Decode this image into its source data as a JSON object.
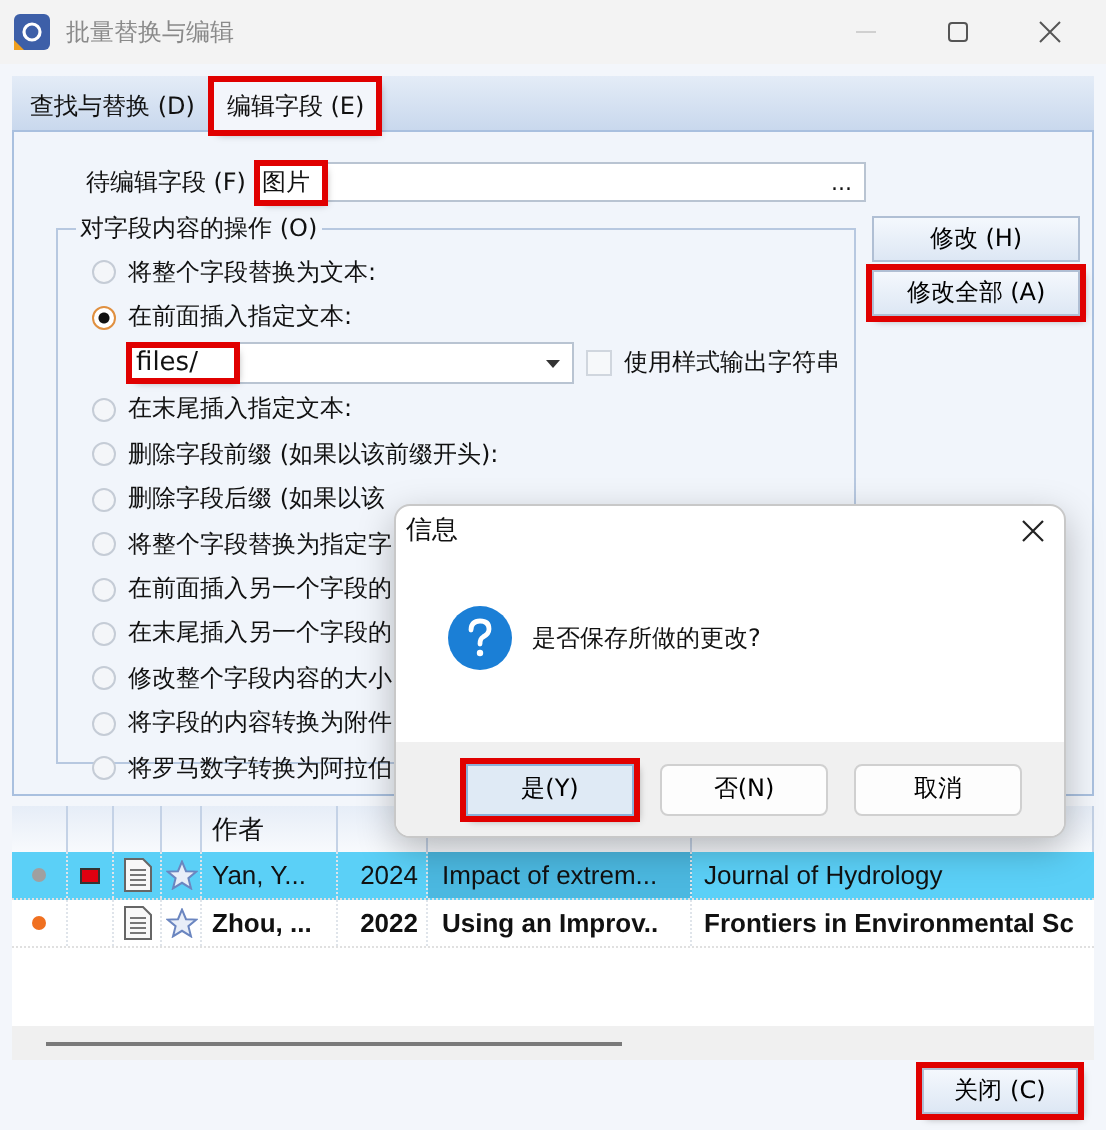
{
  "window": {
    "title": "批量替换与编辑"
  },
  "tabs": [
    {
      "label": "查找与替换 (D)",
      "selected": false,
      "highlighted": false
    },
    {
      "label": "编辑字段 (E)",
      "selected": true,
      "highlighted": true
    }
  ],
  "field": {
    "label": "待编辑字段 (F)",
    "value": "图片",
    "highlighted": true,
    "browse": "..."
  },
  "group": {
    "title": "对字段内容的操作 (O)",
    "options": [
      {
        "label": "将整个字段替换为文本:",
        "selected": false
      },
      {
        "label": "在前面插入指定文本:",
        "selected": true,
        "input": {
          "value": "files/",
          "highlighted": true
        },
        "checkbox": {
          "label": "使用样式输出字符串",
          "checked": false
        }
      },
      {
        "label": "在末尾插入指定文本:",
        "selected": false
      },
      {
        "label": "删除字段前缀 (如果以该前缀开头):",
        "selected": false
      },
      {
        "label": "删除字段后缀 (如果以该",
        "selected": false
      },
      {
        "label": "将整个字段替换为指定字",
        "selected": false
      },
      {
        "label": "在前面插入另一个字段的",
        "selected": false
      },
      {
        "label": "在末尾插入另一个字段的",
        "selected": false
      },
      {
        "label": "修改整个字段内容的大小",
        "selected": false
      },
      {
        "label": "将字段的内容转换为附件",
        "selected": false
      },
      {
        "label": "将罗马数字转换为阿拉伯",
        "selected": false
      }
    ]
  },
  "side_buttons": [
    {
      "label": "修改 (H)",
      "highlighted": false
    },
    {
      "label": "修改全部 (A)",
      "highlighted": true
    }
  ],
  "table": {
    "author_column": "作者",
    "rows": [
      {
        "selected": true,
        "color": "#a0a0a0",
        "flagged": true,
        "bold": false,
        "author": "Yan, Y...",
        "year": "2024",
        "title": "Impact of extrem...",
        "source": "Journal of Hydrology"
      },
      {
        "selected": false,
        "color": "#f07020",
        "flagged": false,
        "bold": true,
        "author": "Zhou, ...",
        "year": "2022",
        "title": "Using an Improv..",
        "source": "Frontiers in Environmental Sc"
      }
    ]
  },
  "close_button": {
    "label": "关闭 (C)",
    "highlighted": true
  },
  "dialog": {
    "title": "信息",
    "message": "是否保存所做的更改?",
    "buttons": [
      {
        "label": "是(Y)",
        "highlighted": true,
        "default": true
      },
      {
        "label": "否(N)",
        "highlighted": false,
        "default": false
      },
      {
        "label": "取消",
        "highlighted": false,
        "default": false
      }
    ]
  }
}
